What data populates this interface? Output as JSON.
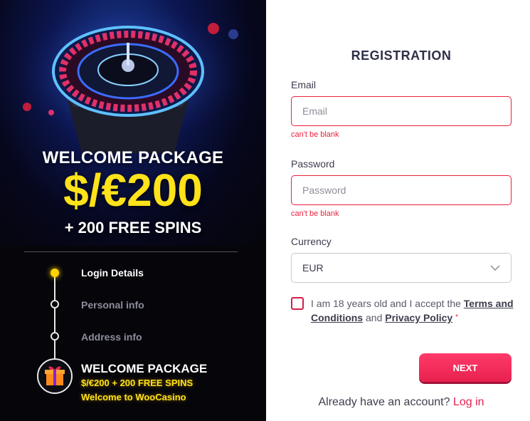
{
  "promo": {
    "title": "WELCOME PACKAGE",
    "amount": "$/€200",
    "spins": "+ 200 FREE SPINS"
  },
  "steps": [
    {
      "label": "Login Details",
      "active": true
    },
    {
      "label": "Personal info",
      "active": false
    },
    {
      "label": "Address info",
      "active": false
    }
  ],
  "package": {
    "title": "WELCOME PACKAGE",
    "line1": "$/€200 + 200 FREE SPINS",
    "line2": "Welcome to WooCasino"
  },
  "form": {
    "title": "REGISTRATION",
    "email": {
      "label": "Email",
      "placeholder": "Email",
      "value": "",
      "error": "can't be blank"
    },
    "password": {
      "label": "Password",
      "placeholder": "Password",
      "value": "",
      "error": "can't be blank"
    },
    "currency": {
      "label": "Currency",
      "selected": "EUR"
    },
    "terms": {
      "prefix": "I am 18 years old and I accept the ",
      "terms_link": "Terms and Conditions",
      "middle": " and ",
      "privacy_link": "Privacy Policy",
      "required_mark": "*"
    },
    "next_label": "NEXT",
    "login_prompt": "Already have an account?",
    "login_link": "Log in"
  },
  "colors": {
    "accent": "#e8214f",
    "highlight": "#ffe219",
    "error": "#e8213c"
  }
}
